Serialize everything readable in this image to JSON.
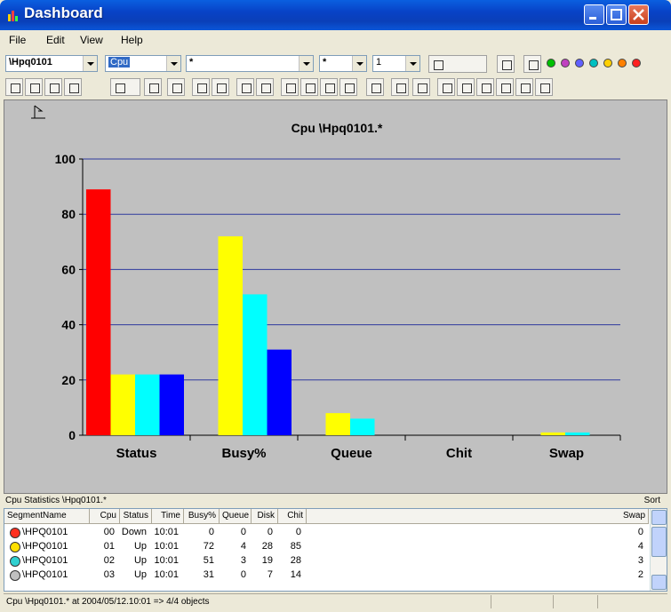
{
  "window": {
    "title": "Dashboard"
  },
  "menu": [
    "File",
    "Edit",
    "View",
    "Help"
  ],
  "toolbar": {
    "host_combo": "\\Hpq0101",
    "object_combo": "Cpu",
    "instance_combo": "*",
    "filter_combo": "*",
    "count_combo": "1"
  },
  "chart_data": {
    "type": "bar",
    "title": "Cpu \\Hpq0101.*",
    "categories": [
      "Status",
      "Busy%",
      "Queue",
      "Chit",
      "Swap"
    ],
    "series": [
      {
        "values": [
          89,
          0,
          0,
          0,
          0
        ],
        "color": "#ff0000"
      },
      {
        "values": [
          22,
          72,
          8,
          0,
          1
        ],
        "color": "#ffff00"
      },
      {
        "values": [
          22,
          51,
          6,
          0,
          1
        ],
        "color": "#00ffff"
      },
      {
        "values": [
          22,
          31,
          0,
          0,
          0
        ],
        "color": "#0000ff"
      }
    ],
    "ylim": [
      0,
      100
    ],
    "yticks": [
      0,
      20,
      40,
      60,
      80,
      100
    ],
    "grid": true,
    "background": "#c0c0c0"
  },
  "stats": {
    "title": "Cpu Statistics \\Hpq0101.*",
    "sort_label": "Sort",
    "columns": [
      "SegmentName",
      "Cpu",
      "Status",
      "Time",
      "Busy%",
      "Queue",
      "Disk",
      "Chit",
      "Swap"
    ],
    "rows": [
      {
        "icon": "red-x-icon",
        "cells": [
          "\\HPQ0101",
          "00",
          "Down",
          "10:01",
          "0",
          "0",
          "0",
          "0",
          "0"
        ]
      },
      {
        "icon": "yellow-diamond-icon",
        "cells": [
          "\\HPQ0101",
          "01",
          "Up",
          "10:01",
          "72",
          "4",
          "28",
          "85",
          "4"
        ]
      },
      {
        "icon": "cyan-circle-icon",
        "cells": [
          "\\HPQ0101",
          "02",
          "Up",
          "10:01",
          "51",
          "3",
          "19",
          "28",
          "3"
        ]
      },
      {
        "icon": "gray-circle-icon",
        "cells": [
          "\\HPQ0101",
          "03",
          "Up",
          "10:01",
          "31",
          "0",
          "7",
          "14",
          "2"
        ]
      }
    ]
  },
  "statusbar": {
    "text": "Cpu \\Hpq0101.* at 2004/05/12.10:01 => 4/4 objects"
  }
}
